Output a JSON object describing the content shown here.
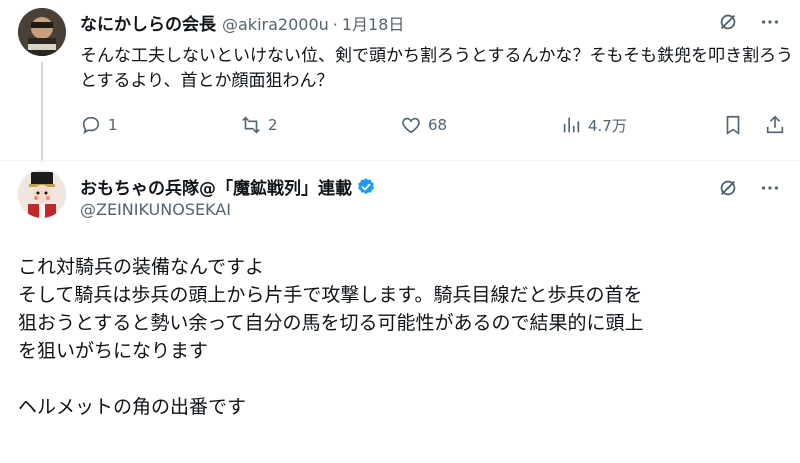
{
  "reply_tweet": {
    "author_name": "なにかしらの会長",
    "handle": "@akira2000u",
    "separator": "·",
    "date": "1月18日",
    "text": "そんな工夫しないといけない位、剣で頭かち割ろうとするんかな？そもそも鉄兜を叩き割ろうとするより、首とか顔面狙わん？",
    "actions": {
      "reply_count": "1",
      "retweet_count": "2",
      "like_count": "68",
      "view_count": "4.7万"
    },
    "icons": [
      "grok-icon",
      "more-icon",
      "reply-icon",
      "retweet-icon",
      "like-icon",
      "views-icon",
      "bookmark-icon",
      "share-icon"
    ]
  },
  "main_tweet": {
    "author_name": "おもちゃの兵隊@「魔鉱戦列」連載",
    "handle": "@ZEINIKUNOSEKAI",
    "verified": true,
    "lines": [
      "これ対騎兵の装備なんですよ",
      "そして騎兵は歩兵の頭上から片手で攻撃します。騎兵目線だと歩兵の首を",
      "狙おうとすると勢い余って自分の馬を切る可能性があるので結果的に頭上",
      "を狙いがちになります",
      "",
      "ヘルメットの角の出番です"
    ]
  },
  "colors": {
    "text": "#0f1419",
    "secondary": "#536471",
    "verified": "#1d9bf0",
    "thread_line": "#cfd9de"
  }
}
